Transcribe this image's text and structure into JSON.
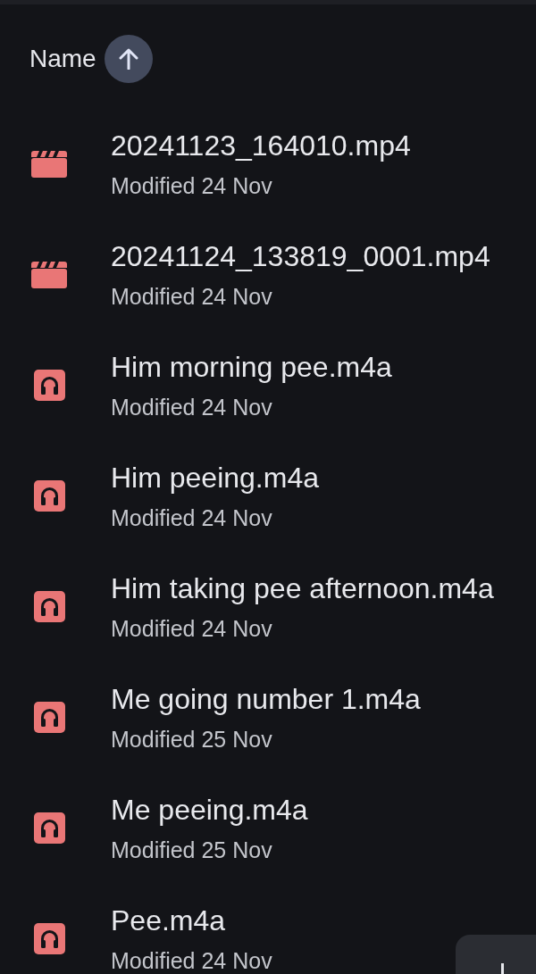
{
  "sort_header": {
    "label": "Name",
    "ascending": true
  },
  "files": [
    {
      "kind": "video",
      "name": "20241123_164010.mp4",
      "modified": "Modified 24 Nov"
    },
    {
      "kind": "video",
      "name": "20241124_133819_0001.mp4",
      "modified": "Modified 24 Nov"
    },
    {
      "kind": "audio",
      "name": "Him morning pee.m4a",
      "modified": "Modified 24 Nov"
    },
    {
      "kind": "audio",
      "name": "Him peeing.m4a",
      "modified": "Modified 24 Nov"
    },
    {
      "kind": "audio",
      "name": "Him taking pee afternoon.m4a",
      "modified": "Modified 24 Nov"
    },
    {
      "kind": "audio",
      "name": "Me going number 1.m4a",
      "modified": "Modified 25 Nov"
    },
    {
      "kind": "audio",
      "name": "Me peeing.m4a",
      "modified": "Modified 25 Nov"
    },
    {
      "kind": "audio",
      "name": "Pee.m4a",
      "modified": "Modified 24 Nov"
    }
  ]
}
